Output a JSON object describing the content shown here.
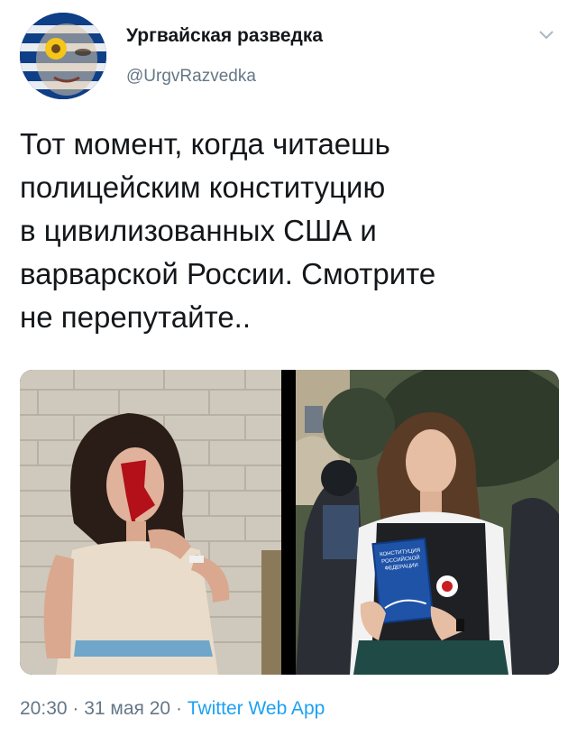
{
  "author": {
    "display_name": "Ургвайская разведка",
    "handle": "@UrgvRazvedka",
    "avatar_icon": "uruguay-flag-face-avatar"
  },
  "menu_icon": "chevron-down-icon",
  "tweet": {
    "text": "Тот момент, когда читаешь\nполицейским конституцию\nв цивилизованных США и\nварварской России. Смотрите\nне перепутайте.."
  },
  "media": {
    "left_photo": "woman-bleeding-brick-wall-photo",
    "right_photo": "woman-reading-constitution-police-photo",
    "book_cover_lines": [
      "КОНСТИТУЦИЯ",
      "РОССИЙСКОЙ",
      "ФЕДЕРАЦИИ"
    ]
  },
  "meta": {
    "time": "20:30",
    "separator": " · ",
    "date": "31 мая 20",
    "source": "Twitter Web App"
  },
  "colors": {
    "text": "#14171a",
    "secondary": "#657786",
    "link": "#1da1f2"
  }
}
